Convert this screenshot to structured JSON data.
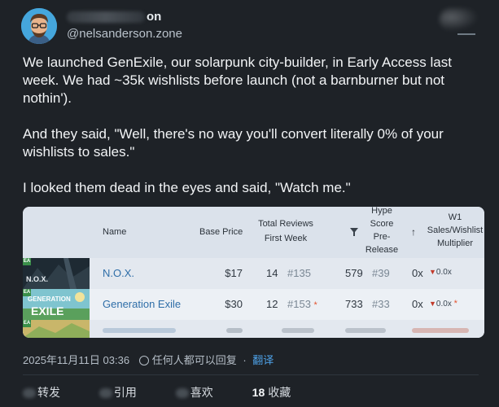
{
  "tweet": {
    "display_name_visible": "on",
    "handle": "@nelsanderson.zone",
    "paragraphs": [
      "We launched GenExile, our solarpunk city-builder, in Early Access last week. We had ~35k wishlists before launch (not a barnburner but not nothin').",
      "And they said, \"Well, there's no way you'll convert literally 0% of your wishlists to sales.\"",
      "I looked them dead in the eyes and said, \"Watch me.\""
    ],
    "date": "2025年11月11日 03:36",
    "visibility": "任何人都可以回复",
    "translate": "翻译",
    "stats": {
      "repost_label": "转发",
      "quote_label": "引用",
      "like_label": "喜欢",
      "bookmark_count": "18",
      "bookmark_label": "收藏"
    }
  },
  "table": {
    "headers": {
      "name": "Name",
      "base_price": "Base Price",
      "total_reviews": "Total Reviews",
      "first_week": "First Week",
      "hype_score": [
        "Hype",
        "Score",
        "Pre-",
        "Release"
      ],
      "w1": "W1",
      "multiplier": [
        "Sales/Wishlist",
        "Multiplier"
      ]
    },
    "rows": [
      {
        "name": "N.O.X.",
        "price": "$17",
        "reviews": "14",
        "reviews_rank": "#135",
        "hype": "579",
        "hype_rank": "#39",
        "mult": "0x",
        "mult_tag": "0.0x",
        "starred": false,
        "ea": "EA",
        "thumb_text": "N.O.X."
      },
      {
        "name": "Generation Exile",
        "price": "$30",
        "reviews": "12",
        "reviews_rank": "#153",
        "hype": "733",
        "hype_rank": "#33",
        "mult": "0x",
        "mult_tag": "0.0x",
        "starred": true,
        "ea": "EA",
        "thumb_text": "GENERATION EXILE"
      }
    ],
    "colors": {
      "accent_link": "#2f6ea8",
      "down_arrow": "#c23a2b",
      "star": "#e4532f"
    }
  }
}
